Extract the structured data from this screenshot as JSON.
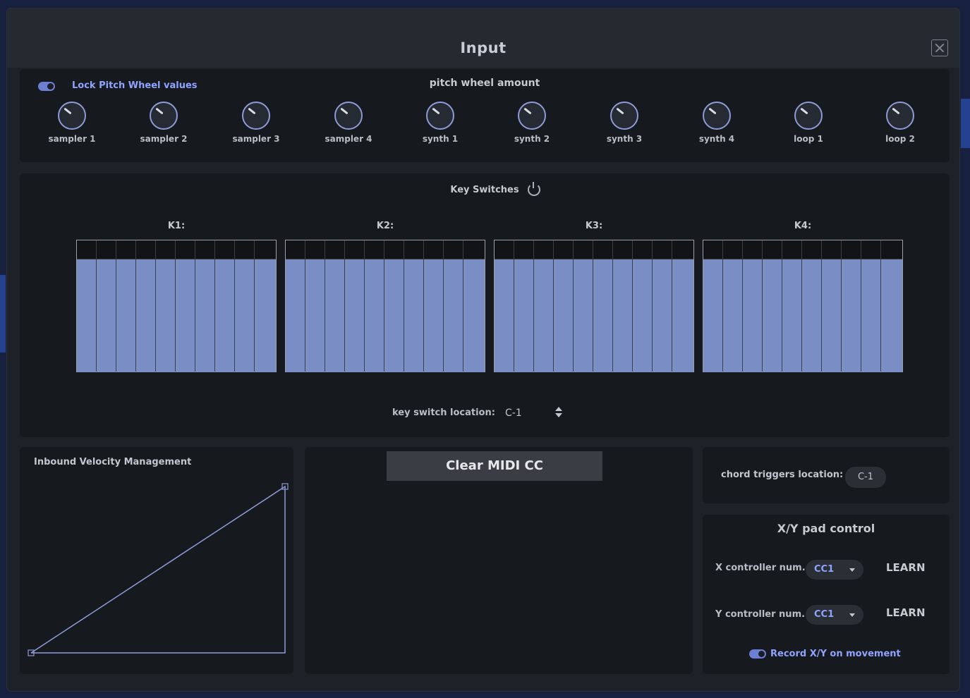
{
  "window": {
    "title": "Input"
  },
  "pitch_wheel": {
    "lock_label": "Lock Pitch Wheel values",
    "lock_on": true,
    "title": "pitch wheel amount",
    "knobs": [
      "sampler 1",
      "sampler 2",
      "sampler 3",
      "sampler 4",
      "synth 1",
      "synth 2",
      "synth 3",
      "synth 4",
      "loop 1",
      "loop 2"
    ]
  },
  "key_switches": {
    "title": "Key Switches",
    "groups": [
      "K1:",
      "K2:",
      "K3:",
      "K4:"
    ],
    "location_label": "key switch location:",
    "location_value": "C-1"
  },
  "velocity": {
    "title": "Inbound Velocity Management"
  },
  "midi": {
    "clear_label": "Clear MIDI CC"
  },
  "chord": {
    "label": "chord triggers location:",
    "value": "C-1"
  },
  "xy": {
    "title": "X/Y pad control",
    "x_label": "X controller num.",
    "x_value": "CC1",
    "y_label": "Y controller num.",
    "y_value": "CC1",
    "learn_label": "LEARN",
    "record_label": "Record X/Y on movement",
    "record_on": true
  },
  "colors": {
    "accent": "#8fa3ff",
    "key_fill": "#7a8dc5",
    "panel": "#16191e"
  }
}
